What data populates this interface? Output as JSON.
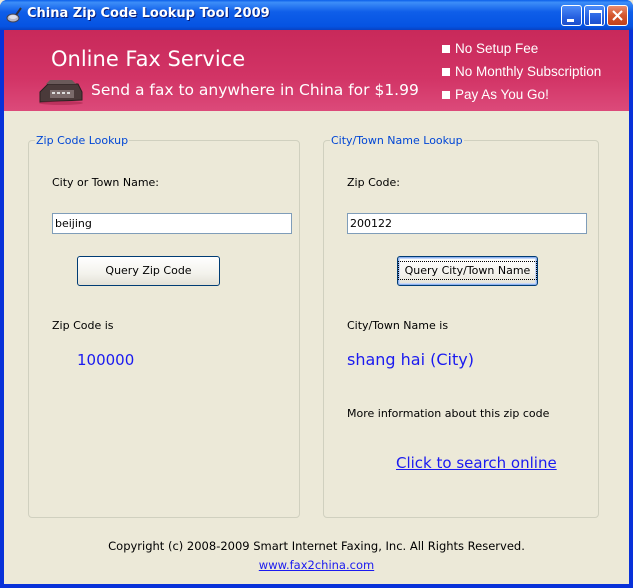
{
  "window": {
    "title": "China Zip Code Lookup Tool 2009",
    "controls": [
      "minimize",
      "maximize",
      "close"
    ]
  },
  "banner": {
    "title": "Online Fax Service",
    "subtitle": "Send a fax to anywhere in China for $1.99",
    "icon": "fax-machine-icon",
    "features": [
      "No Setup Fee",
      "No Monthly Subscription",
      "Pay As You Go!"
    ]
  },
  "zip_lookup": {
    "legend": "Zip Code Lookup",
    "input_label": "City or Town Name:",
    "input_value": "beijing",
    "button_label": "Query Zip Code",
    "result_label": "Zip Code is",
    "result_value": "100000"
  },
  "city_lookup": {
    "legend": "City/Town Name Lookup",
    "input_label": "Zip Code:",
    "input_value": "200122",
    "button_label": "Query City/Town Name",
    "result_label": "City/Town Name is",
    "result_value": "shang hai (City)",
    "more_info_label": "More information about this zip code",
    "search_link": "Click to search online"
  },
  "footer": {
    "copyright": "Copyright (c) 2008-2009 Smart Internet Faxing, Inc. All Rights Reserved.",
    "website_link": "www.fax2china.com"
  },
  "colors": {
    "titlebar": "#0553E2",
    "banner": "#D23466",
    "legend": "#0046D5",
    "result": "#1A1AF0",
    "background": "#ECE9D8"
  }
}
